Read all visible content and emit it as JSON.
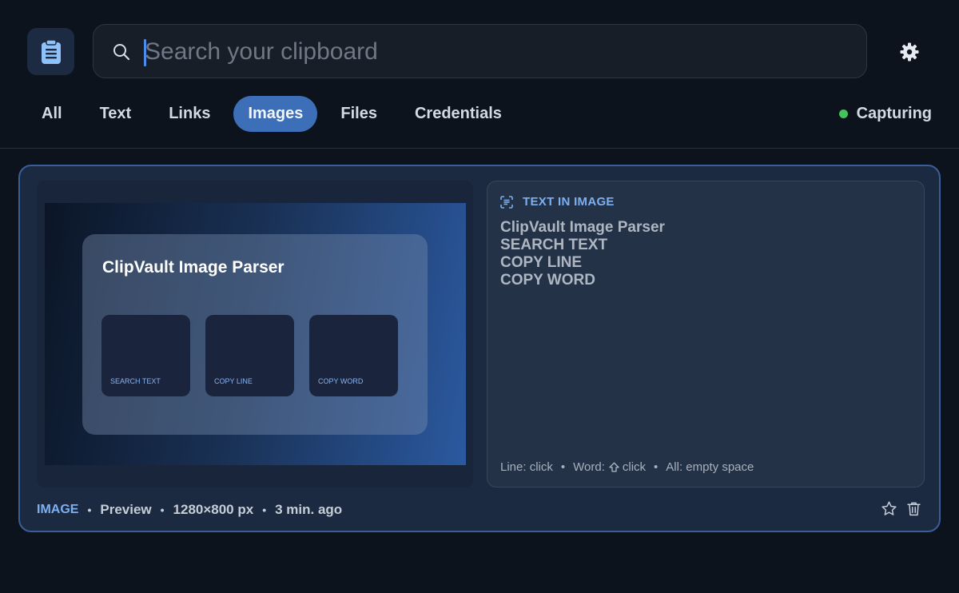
{
  "app": {
    "icon": "clipboard-icon"
  },
  "search": {
    "placeholder": "Search your clipboard",
    "value": ""
  },
  "settings": {
    "icon": "gear-icon"
  },
  "tabs": [
    {
      "label": "All"
    },
    {
      "label": "Text"
    },
    {
      "label": "Links"
    },
    {
      "label": "Images",
      "active": true
    },
    {
      "label": "Files"
    },
    {
      "label": "Credentials"
    }
  ],
  "status": {
    "label": "Capturing",
    "color": "#45c15d"
  },
  "card": {
    "preview": {
      "title": "ClipVault Image Parser",
      "tiles": [
        "SEARCH TEXT",
        "COPY LINE",
        "COPY WORD"
      ]
    },
    "ocr": {
      "heading": "TEXT IN IMAGE",
      "lines": [
        "ClipVault Image Parser",
        "SEARCH TEXT",
        "COPY LINE",
        "COPY WORD"
      ],
      "hints": {
        "line": "Line: click",
        "word_prefix": "Word:",
        "word_suffix": "click",
        "all": "All: empty space"
      }
    },
    "meta": {
      "type": "IMAGE",
      "kind": "Preview",
      "dimensions": "1280×800 px",
      "time": "3 min. ago"
    },
    "actions": {
      "favorite": "star-icon",
      "delete": "trash-icon"
    }
  },
  "colors": {
    "accent": "#3c6fb8",
    "accent_text": "#7db0f0",
    "background": "#0d131c"
  }
}
